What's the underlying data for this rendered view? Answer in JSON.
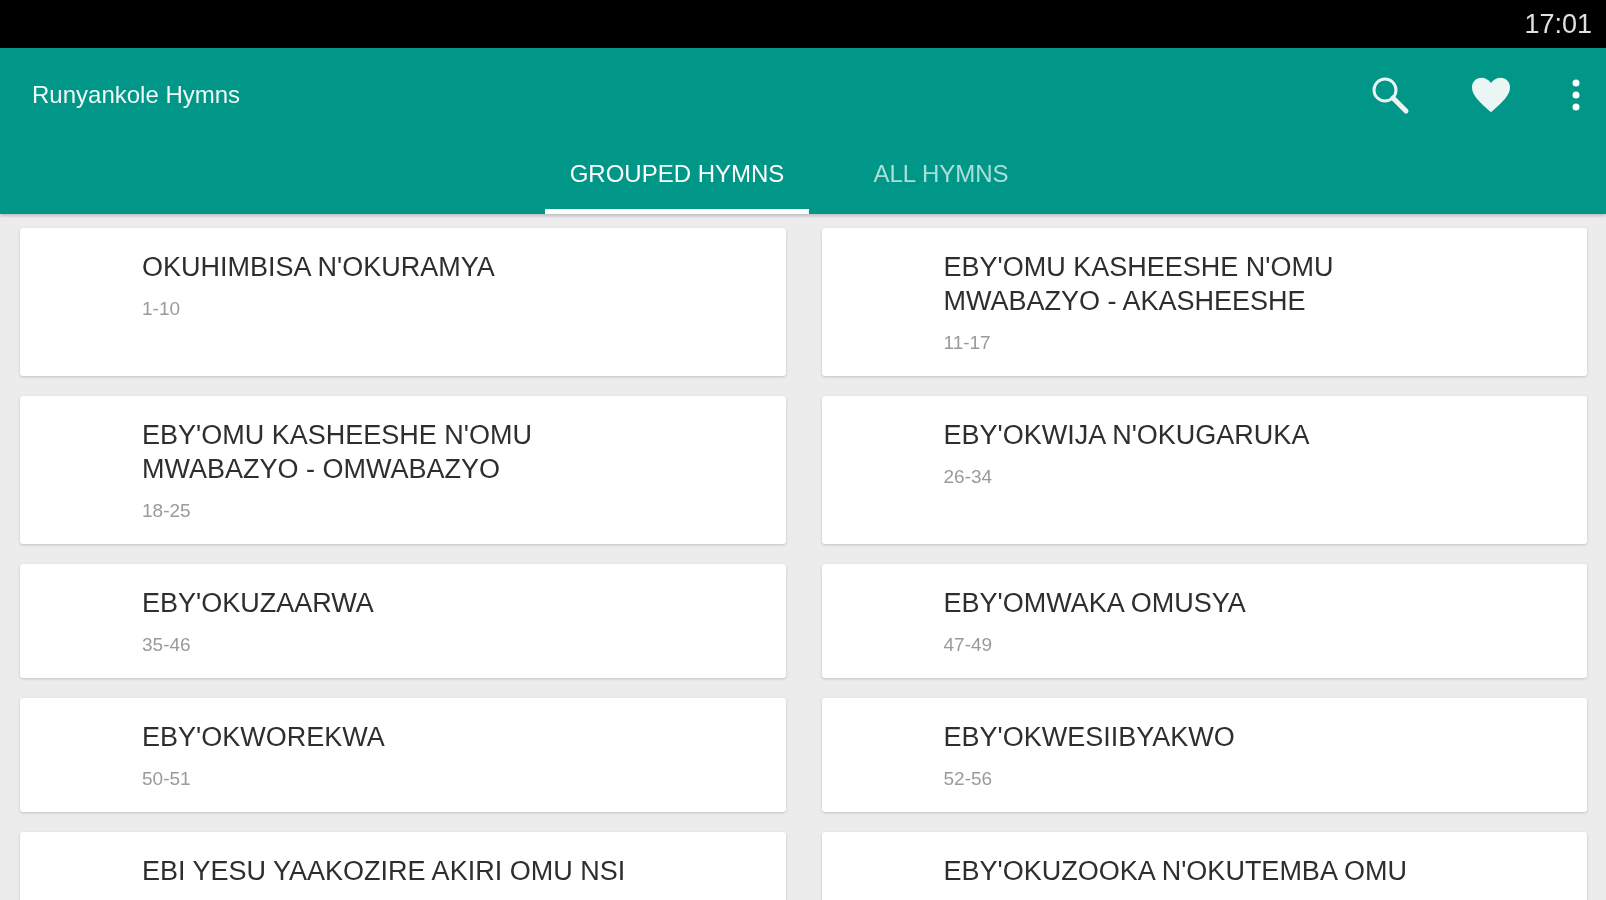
{
  "status_bar": {
    "time": "17:01"
  },
  "toolbar": {
    "title": "Runyankole Hymns"
  },
  "tabs": [
    {
      "label": "GROUPED HYMNS",
      "selected": true
    },
    {
      "label": "ALL HYMNS",
      "selected": false
    }
  ],
  "groups": [
    {
      "title": "OKUHIMBISA N'OKURAMYA",
      "range": "1-10"
    },
    {
      "title": "EBY'OMU KASHEESHE N'OMU",
      "title_line_2": "MWABAZYO - AKASHEESHE",
      "range": "11-17"
    },
    {
      "title": "EBY'OMU KASHEESHE N'OMU",
      "title_line_2": "MWABAZYO - OMWABAZYO",
      "range": "18-25"
    },
    {
      "title": "EBY'OKWIJA N'OKUGARUKA",
      "range": "26-34"
    },
    {
      "title": "EBY'OKUZAARWA",
      "range": "35-46"
    },
    {
      "title": "EBY'OMWAKA OMUSYA",
      "range": "47-49"
    },
    {
      "title": "EBY'OKWOREKWA",
      "range": "50-51"
    },
    {
      "title": "EBY'OKWESIIBYAKWO",
      "range": "52-56"
    },
    {
      "title": "EBI YESU YAAKOZIRE AKIRI OMU NSI"
    },
    {
      "title": "EBY'OKUZOOKA N'OKUTEMBA OMU"
    }
  ]
}
